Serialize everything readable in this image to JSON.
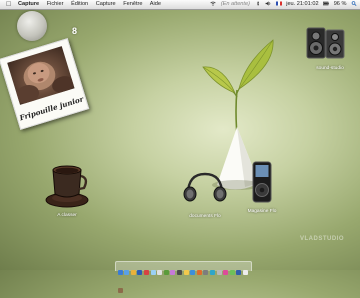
{
  "menubar": {
    "apple_icon": "apple-logo-icon",
    "app_name": "Capture",
    "menus": [
      "Fichier",
      "Édition",
      "Capture",
      "Fenêtre",
      "Aide"
    ],
    "status_text": "(En attente)",
    "clock": "jeu. 21:01:02",
    "battery": "96 %"
  },
  "counter": {
    "value": "8",
    "caption": ""
  },
  "polaroid": {
    "caption": "Fripouille junior"
  },
  "desktop_icons": {
    "speakers": "sound-studio",
    "coffee": "A classer",
    "headphones": "documents Flo",
    "ipod": "Magasine Flo"
  },
  "watermark": "VLADSTUDIO",
  "dock": {
    "colors": [
      "#3a7bd5",
      "#5aa0e6",
      "#e8b23c",
      "#2b5db5",
      "#d64343",
      "#9ad0f5",
      "#e0e0e0",
      "#5b9b3a",
      "#c67ad8",
      "#4c4c4c",
      "#f2c94c",
      "#3d8fd9",
      "#e06a2c",
      "#7d7d7d",
      "#2fa6c9",
      "#b8b8b8",
      "#dd4b9a",
      "#6ec05a",
      "#315eaa",
      "#ededed",
      "#8c6b4a"
    ]
  }
}
